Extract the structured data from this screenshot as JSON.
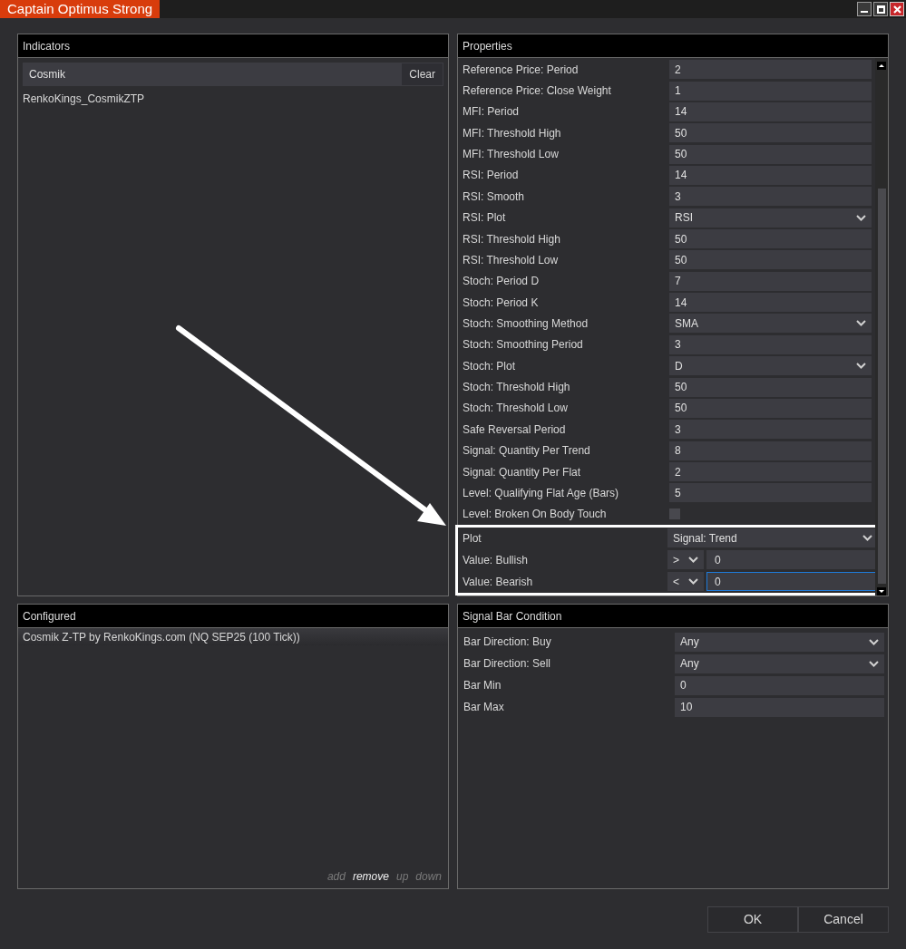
{
  "window": {
    "title": "Captain Optimus Strong"
  },
  "indicators": {
    "title": "Indicators",
    "search": {
      "value": "Cosmik"
    },
    "clear_button": "Clear",
    "items": [
      "RenkoKings_CosmikZTP"
    ]
  },
  "properties": {
    "title": "Properties",
    "rows": [
      {
        "kind": "text",
        "label": "Reference Price: Period",
        "value": "2"
      },
      {
        "kind": "text",
        "label": "Reference Price: Close Weight",
        "value": "1"
      },
      {
        "kind": "text",
        "label": "MFI: Period",
        "value": "14"
      },
      {
        "kind": "text",
        "label": "MFI: Threshold High",
        "value": "50"
      },
      {
        "kind": "text",
        "label": "MFI: Threshold Low",
        "value": "50"
      },
      {
        "kind": "text",
        "label": "RSI: Period",
        "value": "14"
      },
      {
        "kind": "text",
        "label": "RSI: Smooth",
        "value": "3"
      },
      {
        "kind": "select",
        "label": "RSI: Plot",
        "value": "RSI"
      },
      {
        "kind": "text",
        "label": "RSI: Threshold High",
        "value": "50"
      },
      {
        "kind": "text",
        "label": "RSI: Threshold Low",
        "value": "50"
      },
      {
        "kind": "text",
        "label": "Stoch: Period D",
        "value": "7"
      },
      {
        "kind": "text",
        "label": "Stoch: Period K",
        "value": "14"
      },
      {
        "kind": "select",
        "label": "Stoch: Smoothing Method",
        "value": "SMA"
      },
      {
        "kind": "text",
        "label": "Stoch: Smoothing Period",
        "value": "3"
      },
      {
        "kind": "select",
        "label": "Stoch: Plot",
        "value": "D"
      },
      {
        "kind": "text",
        "label": "Stoch: Threshold High",
        "value": "50"
      },
      {
        "kind": "text",
        "label": "Stoch: Threshold Low",
        "value": "50"
      },
      {
        "kind": "text",
        "label": "Safe Reversal Period",
        "value": "3"
      },
      {
        "kind": "text",
        "label": "Signal: Quantity Per Trend",
        "value": "8"
      },
      {
        "kind": "text",
        "label": "Signal: Quantity Per Flat",
        "value": "2"
      },
      {
        "kind": "text",
        "label": "Level: Qualifying Flat Age (Bars)",
        "value": "5"
      },
      {
        "kind": "checkbox",
        "label": "Level: Broken On Body Touch",
        "checked": false
      }
    ],
    "highlighted_rows": [
      {
        "kind": "select",
        "label": "Plot",
        "value": "Signal: Trend"
      },
      {
        "kind": "compare",
        "label": "Value: Bullish",
        "operator": ">",
        "value": "0",
        "focused": false
      },
      {
        "kind": "compare",
        "label": "Value: Bearish",
        "operator": "<",
        "value": "0",
        "focused": true
      }
    ]
  },
  "configured": {
    "title": "Configured",
    "items": [
      {
        "label": "Cosmik Z-TP by RenkoKings.com (NQ SEP25 (100 Tick))",
        "selected": true
      }
    ],
    "actions": [
      {
        "label": "add",
        "disabled": true
      },
      {
        "label": "remove",
        "disabled": false
      },
      {
        "label": "up",
        "disabled": true
      },
      {
        "label": "down",
        "disabled": true
      }
    ]
  },
  "signal_bar_condition": {
    "title": "Signal Bar Condition",
    "rows": [
      {
        "kind": "select",
        "label": "Bar Direction: Buy",
        "value": "Any"
      },
      {
        "kind": "select",
        "label": "Bar Direction: Sell",
        "value": "Any"
      },
      {
        "kind": "text",
        "label": "Bar Min",
        "value": "0"
      },
      {
        "kind": "text",
        "label": "Bar Max",
        "value": "10"
      }
    ]
  },
  "buttons": [
    "OK",
    "Cancel"
  ]
}
